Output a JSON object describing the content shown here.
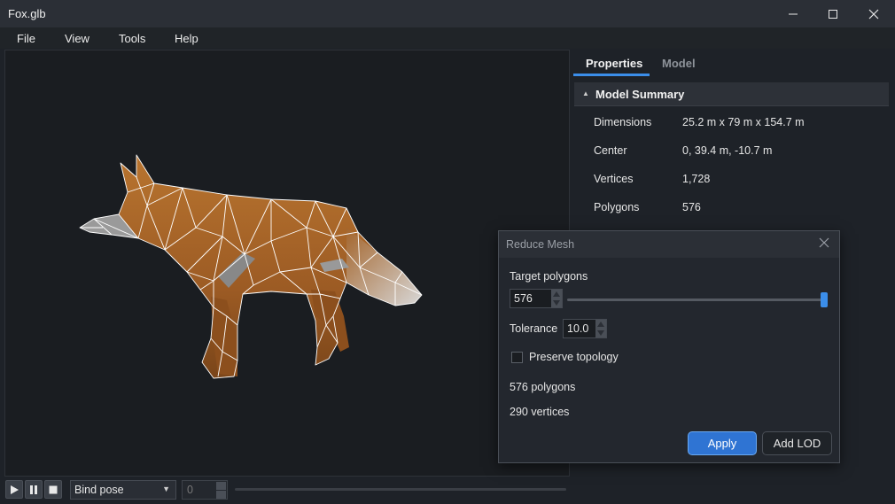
{
  "window": {
    "title": "Fox.glb"
  },
  "menu": [
    "File",
    "View",
    "Tools",
    "Help"
  ],
  "animation": {
    "pose_select": "Bind pose",
    "frame": "0",
    "buttons": [
      "play-icon",
      "pause-icon",
      "stop-icon"
    ]
  },
  "panel": {
    "tabs": [
      "Properties",
      "Model"
    ],
    "active_tab": "Properties",
    "section_title": "Model Summary",
    "properties": [
      {
        "label": "Dimensions",
        "value": "25.2 m x 79 m x 154.7 m"
      },
      {
        "label": "Center",
        "value": "0, 39.4 m, -10.7 m"
      },
      {
        "label": "Vertices",
        "value": "1,728"
      },
      {
        "label": "Polygons",
        "value": "576"
      }
    ]
  },
  "dialog": {
    "title": "Reduce Mesh",
    "target_label": "Target polygons",
    "target_value": "576",
    "slider_level": 1.0,
    "tolerance_label": "Tolerance",
    "tolerance_value": "10.0",
    "preserve_label": "Preserve topology",
    "preserve_checked": false,
    "polygons_text": "576 polygons",
    "vertices_text": "290 vertices",
    "apply_label": "Apply",
    "add_lod_label": "Add LOD"
  },
  "colors": {
    "accent": "#3b8eea",
    "fox_fur": "#a0622a",
    "wireframe": "#ffffff"
  }
}
